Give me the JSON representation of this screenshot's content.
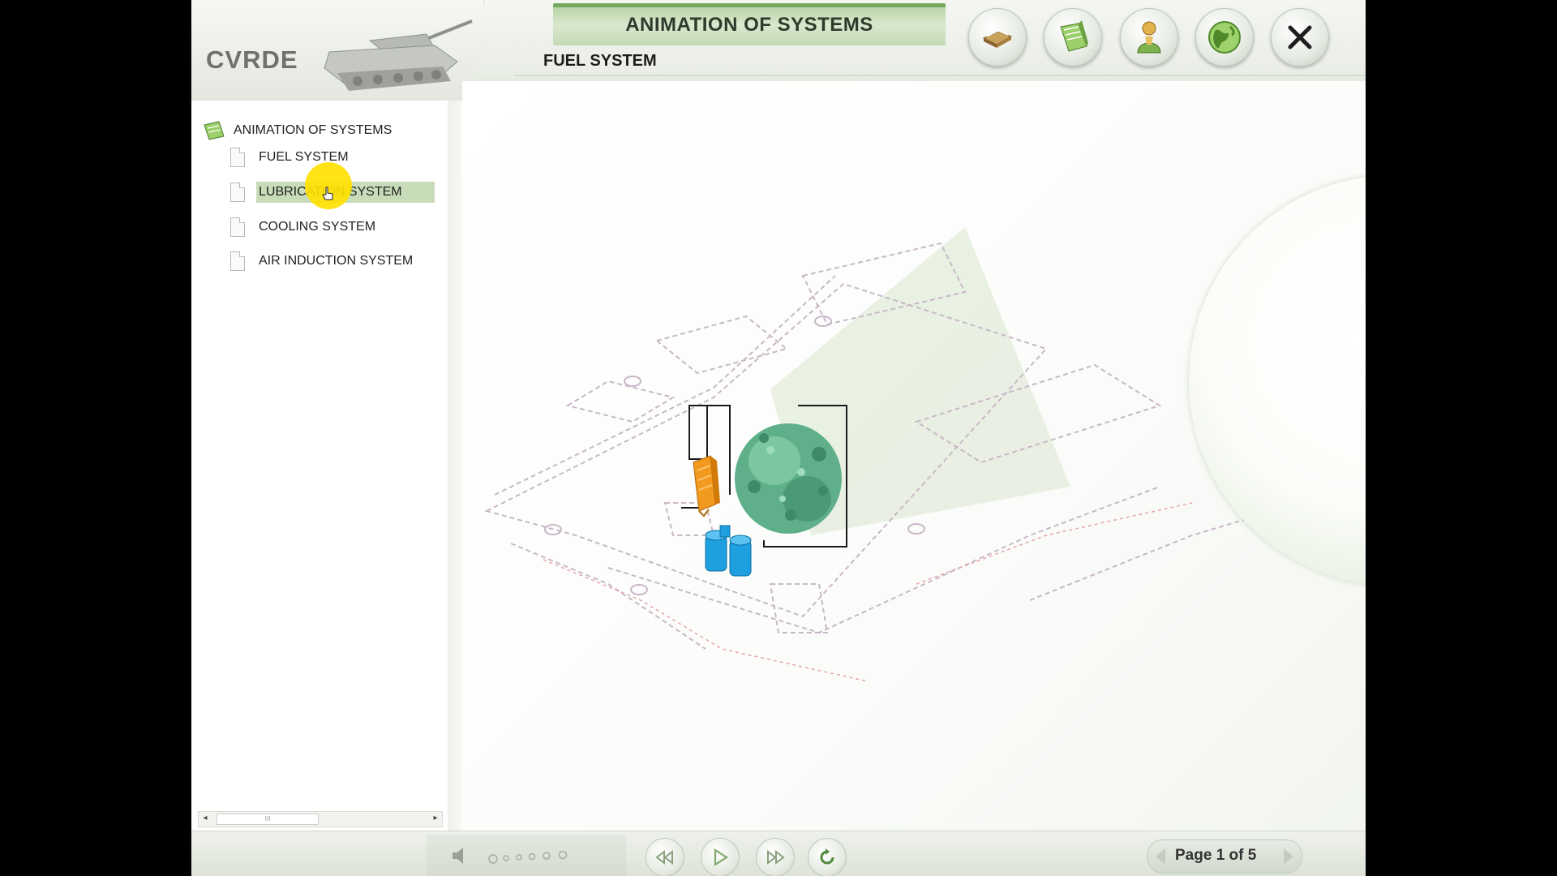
{
  "header": {
    "logo": "CVRDE",
    "title": "ANIMATION OF SYSTEMS",
    "subtitle": "FUEL SYSTEM",
    "tools": [
      {
        "name": "book-icon"
      },
      {
        "name": "bookmark-icon"
      },
      {
        "name": "person-icon"
      },
      {
        "name": "globe-icon"
      },
      {
        "name": "close-icon"
      }
    ]
  },
  "sidebar": {
    "root_label": "ANIMATION OF SYSTEMS",
    "items": [
      {
        "label": "FUEL SYSTEM",
        "selected": false
      },
      {
        "label": "LUBRICATION SYSTEM",
        "selected": true
      },
      {
        "label": "COOLING SYSTEM",
        "selected": false
      },
      {
        "label": "AIR INDUCTION SYSTEM",
        "selected": false
      }
    ],
    "scroll_mark": "III"
  },
  "footer": {
    "page_label": "Page 1 of  5",
    "controls": [
      "rewind-icon",
      "play-icon",
      "fast-forward-icon",
      "replay-icon"
    ]
  },
  "colors": {
    "accent_green": "#76a860",
    "selection": "#c7dcb8",
    "cursor_highlight": "#ffe100",
    "engine": "#5fb08a",
    "filter": "#1e9fe0",
    "pump": "#f29a1f"
  }
}
